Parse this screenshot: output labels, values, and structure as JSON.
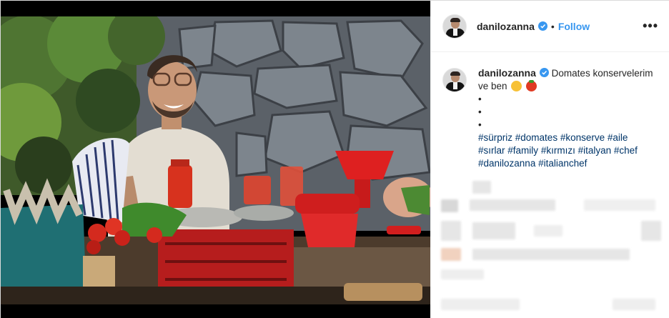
{
  "post": {
    "username": "danilozanna",
    "follow_label": "Follow",
    "more_label": "•••",
    "separator": "•"
  },
  "caption": {
    "username": "danilozanna",
    "text": "Domates konservelerim ve ben",
    "emojis": [
      "laughing-emoji",
      "tomato-emoji"
    ],
    "bullets": [
      "•",
      "•",
      "•"
    ],
    "hashtags": [
      "#sürpriz",
      "#domates",
      "#konserve",
      "#aile",
      "#sırlar",
      "#family",
      "#kırmızı",
      "#italyan",
      "#chef",
      "#danilozanna",
      "#italianchef"
    ]
  },
  "colors": {
    "link_blue": "#3897f0",
    "hashtag": "#003569",
    "verified": "#3897f0"
  },
  "icons": {
    "verified": "verified-badge-icon",
    "more": "more-options-icon"
  }
}
